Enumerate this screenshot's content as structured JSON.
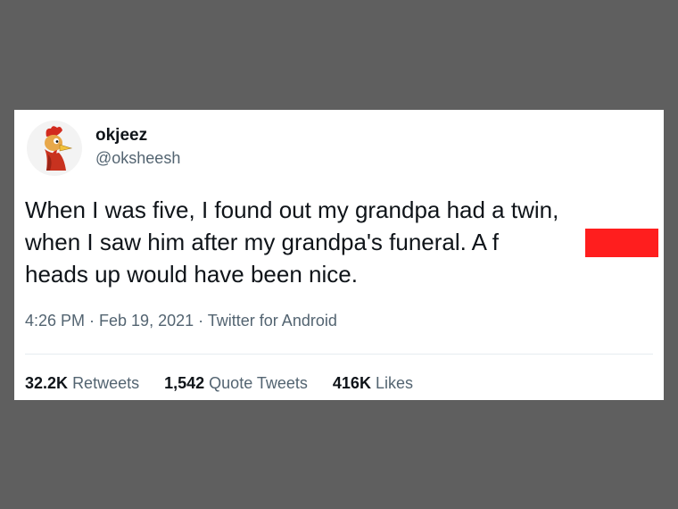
{
  "tweet": {
    "author": {
      "display_name": "okjeez",
      "handle": "@oksheesh",
      "avatar_icon": "rooster-avatar-icon"
    },
    "text_lines": [
      "When I was five, I found out my grandpa had a twin,",
      "when I saw him after my grandpa's funeral. A f",
      "heads up would have been nice."
    ],
    "meta": "4:26 PM · Feb 19, 2021 · Twitter for Android",
    "stats": [
      {
        "count": "32.2K",
        "label": "Retweets"
      },
      {
        "count": "1,542",
        "label": "Quote Tweets"
      },
      {
        "count": "416K",
        "label": "Likes"
      }
    ]
  },
  "colors": {
    "background": "#5f5f5f",
    "card": "#ffffff",
    "redaction": "#ff1e1e",
    "secondary_text": "#536471",
    "primary_text": "#0f1419"
  }
}
